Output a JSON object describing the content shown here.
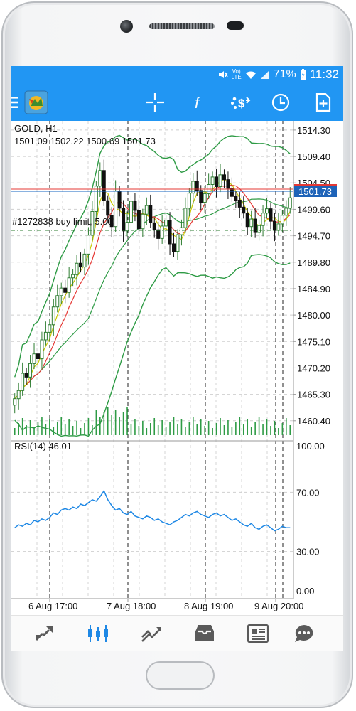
{
  "status": {
    "battery": "71%",
    "time": "11:32",
    "net": "LTE"
  },
  "chart_header": {
    "symbol": "GOLD, H1",
    "ohlc": "1501.09 1502.22 1500.69 1501.73"
  },
  "order_line_label": "#1272838 buy limit, 5.00",
  "current_price": "1501.73",
  "price_axis": [
    "1514.30",
    "1509.40",
    "1504.50",
    "1499.60",
    "1494.70",
    "1489.80",
    "1484.90",
    "1480.00",
    "1475.10",
    "1470.20",
    "1465.30",
    "1460.40"
  ],
  "rsi": {
    "label": "RSI(14) 46.01",
    "axis": [
      "100.00",
      "70.00",
      "30.00",
      "0.00"
    ]
  },
  "time_axis": [
    "6 Aug 17:00",
    "7 Aug 18:00",
    "8 Aug 19:00",
    "9 Aug 20:00"
  ],
  "colors": {
    "accent": "#2196f3",
    "bull": "#2e7d32",
    "bear": "#111111",
    "band": "#2e9b45",
    "ma_red": "#e53935",
    "ma_yellow": "#c8c800",
    "rsi": "#1e88e5",
    "ask_line": "#e53935",
    "bid_line": "#1565c0",
    "price_tag": "#1e63b8"
  },
  "toolbar_icons": [
    "menu-icon",
    "metatrader-logo-icon",
    "crosshair-icon",
    "indicators-icon",
    "timeframe-currency-icon",
    "period-clock-icon",
    "new-order-icon"
  ],
  "nav_icons": [
    "quotes-icon",
    "chart-icon",
    "trade-icon",
    "history-icon",
    "news-icon",
    "messages-icon"
  ],
  "chart_data": {
    "type": "candlestick",
    "symbol": "GOLD",
    "timeframe": "H1",
    "ylim": [
      1458.0,
      1516.0
    ],
    "close_series": [
      1464.5,
      1466.0,
      1469.2,
      1468.5,
      1471.0,
      1472.8,
      1471.9,
      1475.4,
      1476.8,
      1478.2,
      1481.5,
      1483.6,
      1485.0,
      1484.2,
      1486.9,
      1487.5,
      1489.6,
      1488.9,
      1491.3,
      1494.8,
      1499.2,
      1503.9,
      1506.8,
      1501.2,
      1498.5,
      1496.4,
      1503.0,
      1499.8,
      1495.6,
      1497.2,
      1501.1,
      1499.4,
      1496.0,
      1498.7,
      1500.3,
      1497.1,
      1495.8,
      1494.2,
      1496.5,
      1497.6,
      1493.2,
      1491.8,
      1494.9,
      1496.2,
      1499.8,
      1502.6,
      1504.8,
      1503.1,
      1500.9,
      1502.5,
      1504.2,
      1505.6,
      1503.8,
      1506.0,
      1505.1,
      1503.5,
      1502.0,
      1501.3,
      1500.0,
      1498.9,
      1496.4,
      1497.8,
      1495.3,
      1496.6,
      1498.9,
      1499.7,
      1497.4,
      1495.7,
      1496.9,
      1498.5,
      1499.8,
      1501.73
    ],
    "rsi_series": [
      46,
      48,
      47,
      49,
      48,
      51,
      50,
      52,
      51,
      53,
      56,
      55,
      58,
      59,
      58,
      60,
      59,
      62,
      61,
      63,
      65,
      64,
      67,
      71,
      65,
      61,
      58,
      59,
      56,
      55,
      57,
      54,
      53,
      52,
      54,
      53,
      51,
      52,
      50,
      49,
      48,
      50,
      51,
      53,
      55,
      54,
      56,
      57,
      55,
      54,
      53,
      55,
      56,
      54,
      55,
      53,
      51,
      52,
      50,
      48,
      47,
      49,
      46,
      45,
      47,
      48,
      46,
      44,
      45,
      47,
      46,
      46.01
    ]
  }
}
